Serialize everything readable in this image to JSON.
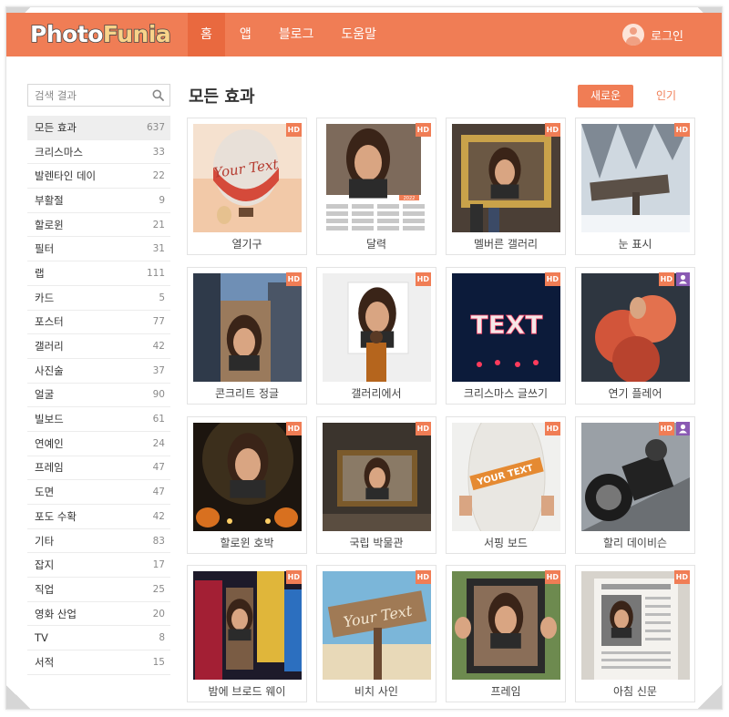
{
  "header": {
    "logo_part1": "Photo",
    "logo_part2": "Funia",
    "nav": [
      "홈",
      "앱",
      "블로그",
      "도움말"
    ],
    "active_nav": 0,
    "login_label": "로그인"
  },
  "sidebar": {
    "search_placeholder": "검색 결과",
    "categories": [
      {
        "label": "모든 효과",
        "count": "637",
        "active": true
      },
      {
        "label": "크리스마스",
        "count": "33"
      },
      {
        "label": "발렌타인 데이",
        "count": "22"
      },
      {
        "label": "부활절",
        "count": "9"
      },
      {
        "label": "할로윈",
        "count": "21"
      },
      {
        "label": "필터",
        "count": "31"
      },
      {
        "label": "랩",
        "count": "111"
      },
      {
        "label": "카드",
        "count": "5"
      },
      {
        "label": "포스터",
        "count": "77"
      },
      {
        "label": "갤러리",
        "count": "42"
      },
      {
        "label": "사진술",
        "count": "37"
      },
      {
        "label": "얼굴",
        "count": "90"
      },
      {
        "label": "빌보드",
        "count": "61"
      },
      {
        "label": "연예인",
        "count": "24"
      },
      {
        "label": "프레임",
        "count": "47"
      },
      {
        "label": "도면",
        "count": "47"
      },
      {
        "label": "포도 수확",
        "count": "42"
      },
      {
        "label": "기타",
        "count": "83"
      },
      {
        "label": "잡지",
        "count": "17"
      },
      {
        "label": "직업",
        "count": "25"
      },
      {
        "label": "영화 산업",
        "count": "20"
      },
      {
        "label": "TV",
        "count": "8"
      },
      {
        "label": "서적",
        "count": "15"
      }
    ]
  },
  "main": {
    "title": "모든 효과",
    "sort_new": "새로운",
    "sort_popular": "인기",
    "effects": [
      {
        "caption": "열기구",
        "hd": true,
        "user": false,
        "thumb": "balloon",
        "thumb_text": "Your Text"
      },
      {
        "caption": "달력",
        "hd": true,
        "user": false,
        "thumb": "calendar",
        "thumb_text": "2022"
      },
      {
        "caption": "멜버른 갤러리",
        "hd": true,
        "user": false,
        "thumb": "gallery-frame"
      },
      {
        "caption": "눈 표시",
        "hd": true,
        "user": false,
        "thumb": "snow-sign"
      },
      {
        "caption": "콘크리트 정글",
        "hd": true,
        "user": false,
        "thumb": "concrete"
      },
      {
        "caption": "갤러리에서",
        "hd": true,
        "user": false,
        "thumb": "gallery-wall"
      },
      {
        "caption": "크리스마스 글쓰기",
        "hd": true,
        "user": false,
        "thumb": "neon",
        "thumb_text": "TEXT"
      },
      {
        "caption": "연기 플레어",
        "hd": true,
        "user": true,
        "thumb": "smoke"
      },
      {
        "caption": "할로윈 호박",
        "hd": true,
        "user": false,
        "thumb": "halloween"
      },
      {
        "caption": "국립 박물관",
        "hd": true,
        "user": false,
        "thumb": "museum"
      },
      {
        "caption": "서핑 보드",
        "hd": true,
        "user": false,
        "thumb": "surf",
        "thumb_text": "YOUR TEXT"
      },
      {
        "caption": "할리 데이비슨",
        "hd": true,
        "user": true,
        "thumb": "moto"
      },
      {
        "caption": "밤에 브로드 웨이",
        "hd": true,
        "user": false,
        "thumb": "broadway"
      },
      {
        "caption": "비치 사인",
        "hd": true,
        "user": false,
        "thumb": "beach-sign",
        "thumb_text": "Your Text"
      },
      {
        "caption": "프레임",
        "hd": true,
        "user": false,
        "thumb": "frame-hands"
      },
      {
        "caption": "아침 신문",
        "hd": true,
        "user": false,
        "thumb": "newspaper"
      }
    ],
    "badge_hd": "HD"
  },
  "colors": {
    "accent": "#f07d55",
    "accent_dark": "#e9693f",
    "user_badge": "#8a5ab3"
  },
  "icons": {
    "search": "search-icon",
    "avatar": "user-avatar-icon",
    "user_badge": "user-icon"
  }
}
